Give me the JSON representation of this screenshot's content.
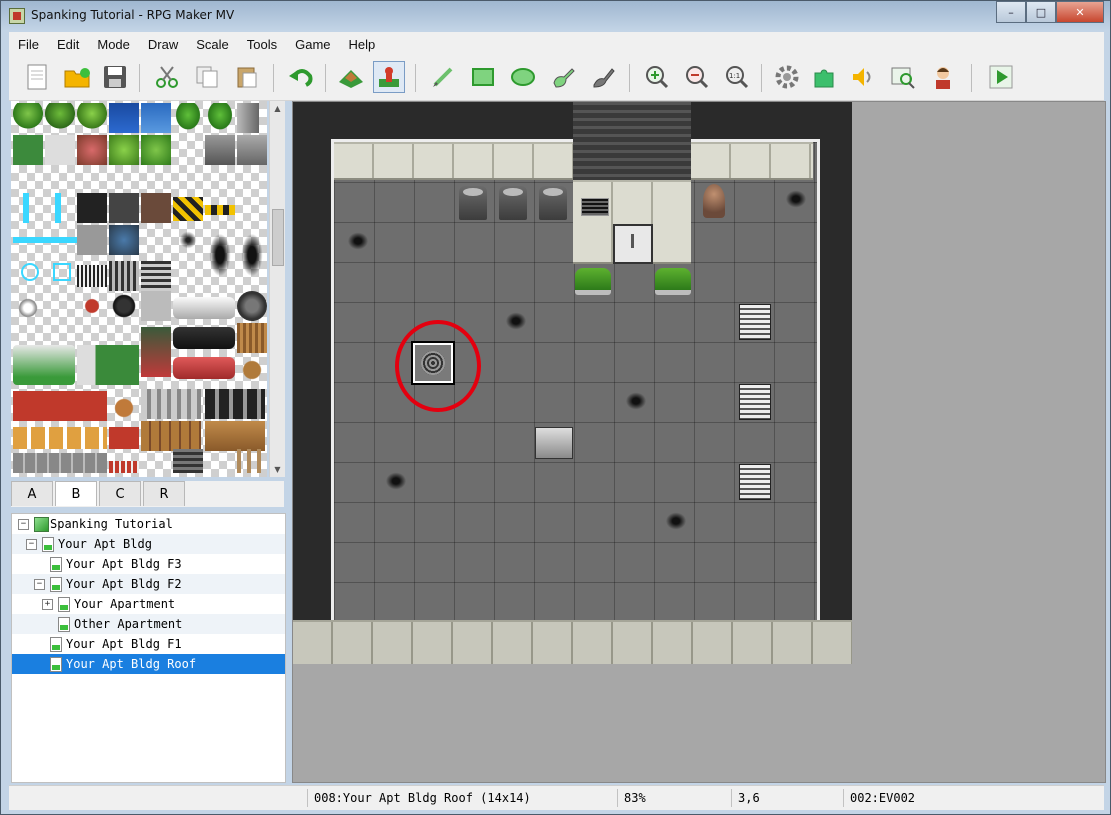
{
  "window": {
    "title": "Spanking Tutorial - RPG Maker MV",
    "minimize": "–",
    "maximize": "□",
    "close": "✕"
  },
  "menu": [
    "File",
    "Edit",
    "Mode",
    "Draw",
    "Scale",
    "Tools",
    "Game",
    "Help"
  ],
  "toolbar": {
    "icons": [
      "new-project-icon",
      "open-project-icon",
      "save-project-icon",
      "cut-icon",
      "copy-icon",
      "paste-icon",
      "undo-icon",
      "map-mode-icon",
      "event-mode-icon",
      "pencil-icon",
      "rectangle-icon",
      "ellipse-icon",
      "fill-icon",
      "shadow-pen-icon",
      "zoom-in-icon",
      "zoom-out-icon",
      "zoom-actual-icon",
      "database-icon",
      "plugin-manager-icon",
      "sound-test-icon",
      "event-searcher-icon",
      "character-generator-icon",
      "playtest-icon"
    ],
    "active_tool": "event-mode-icon"
  },
  "tileset_tabs": [
    "A",
    "B",
    "C",
    "R"
  ],
  "selected_tab": "B",
  "map_tree": [
    {
      "label": "Spanking Tutorial",
      "level": 0,
      "expander": "−",
      "kind": "project"
    },
    {
      "label": "Your Apt Bldg",
      "level": 1,
      "expander": "−",
      "kind": "map"
    },
    {
      "label": "Your Apt Bldg F3",
      "level": 2,
      "expander": "",
      "kind": "map"
    },
    {
      "label": "Your Apt Bldg F2",
      "level": 2,
      "expander": "−",
      "kind": "map"
    },
    {
      "label": "Your Apartment",
      "level": 3,
      "expander": "+",
      "kind": "map"
    },
    {
      "label": "Other Apartment",
      "level": 4,
      "expander": "",
      "kind": "map"
    },
    {
      "label": "Your Apt Bldg F1",
      "level": 2,
      "expander": "",
      "kind": "map"
    },
    {
      "label": "Your Apt Bldg Roof",
      "level": 2,
      "expander": "",
      "kind": "map",
      "selected": true
    }
  ],
  "status": {
    "map": "008:Your Apt Bldg Roof (14x14)",
    "zoom": "83%",
    "coords": "3,6",
    "event": "002:EV002"
  },
  "colors": {
    "selection": "#1a7fe0",
    "highlight_circle": "#e3000f"
  }
}
